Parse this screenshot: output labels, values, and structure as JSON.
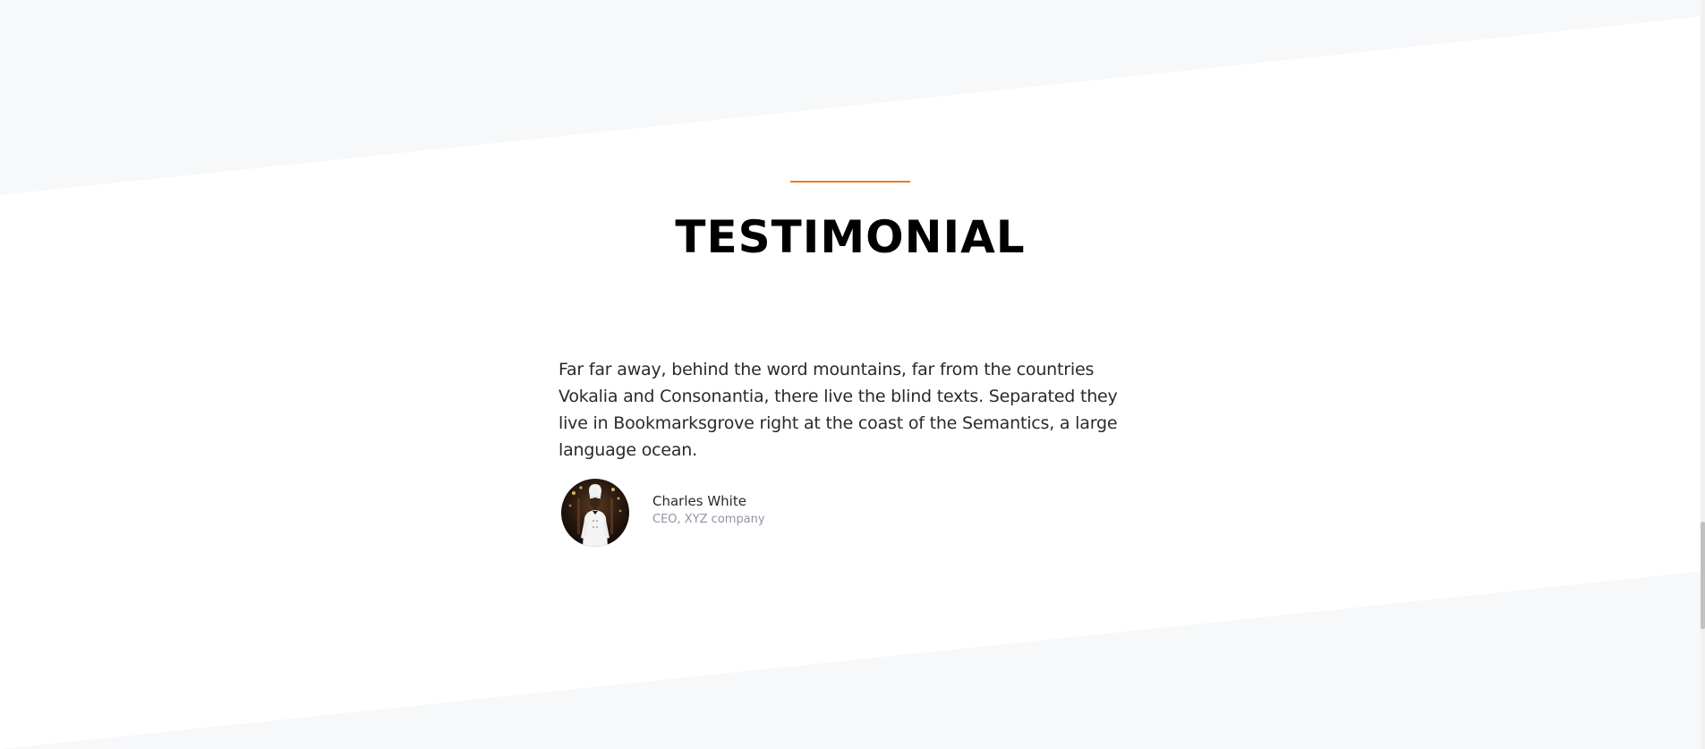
{
  "colors": {
    "accent": "#f07b1e",
    "background_alt": "#f7f8fa",
    "background": "#ffffff",
    "title": "#000000",
    "muted": "#8e95a0"
  },
  "testimonial_section": {
    "title": "TESTIMONIAL",
    "quote": "Far far away, behind the word mountains, far from the countries Vokalia and Consonantia, there live the blind texts. Separated they live in Bookmarksgrove right at the coast of the Semantics, a large language ocean.",
    "author": {
      "name": "Charles White",
      "role": "CEO, XYZ company",
      "avatar_icon": "chef-portrait-avatar"
    }
  }
}
